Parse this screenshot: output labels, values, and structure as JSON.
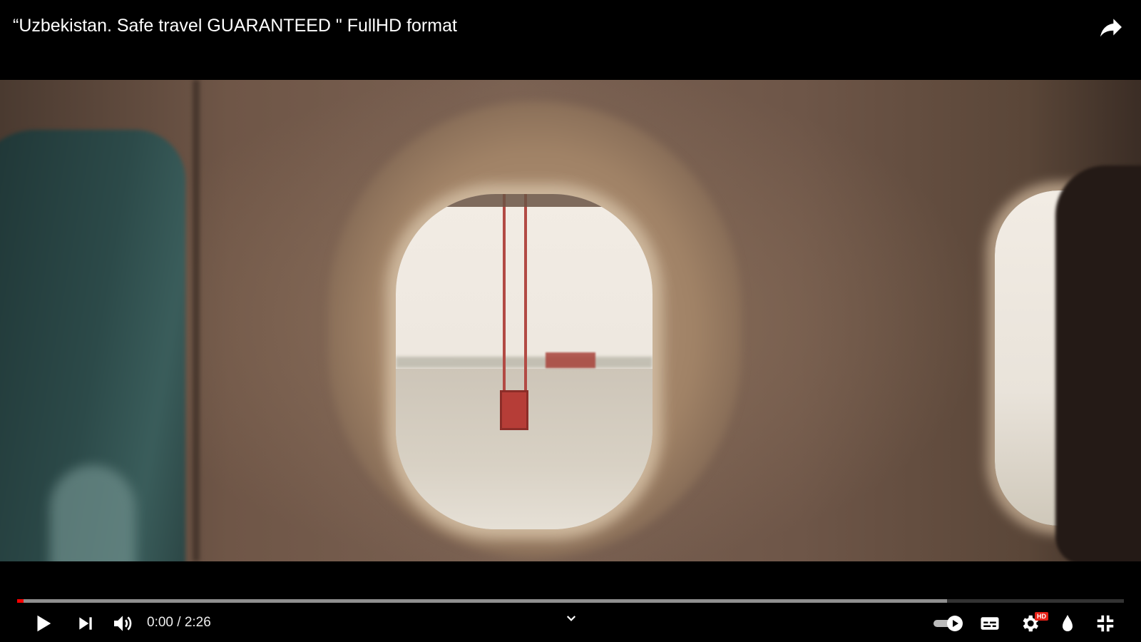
{
  "player": {
    "title": "“Uzbekistan. Safe travel GUARANTEED \" FullHD format",
    "current_time": "0:00",
    "separator": "/",
    "duration": "2:26",
    "progress_played_fraction": 0.006,
    "progress_buffered_fraction": 0.84,
    "autoplay_on": true,
    "quality_badge": "HD",
    "colors": {
      "progress_played": "#ff0000",
      "hd_badge": "#e62117"
    },
    "icons": {
      "share": "share-icon",
      "play": "play-icon",
      "next": "next-icon",
      "volume": "volume-icon",
      "expand": "chevron-down-icon",
      "autoplay": "autoplay-toggle",
      "captions": "subtitles-icon",
      "settings": "gear-icon",
      "ambient": "ambient-drop-icon",
      "exit_fullscreen": "exit-fullscreen-icon"
    }
  }
}
